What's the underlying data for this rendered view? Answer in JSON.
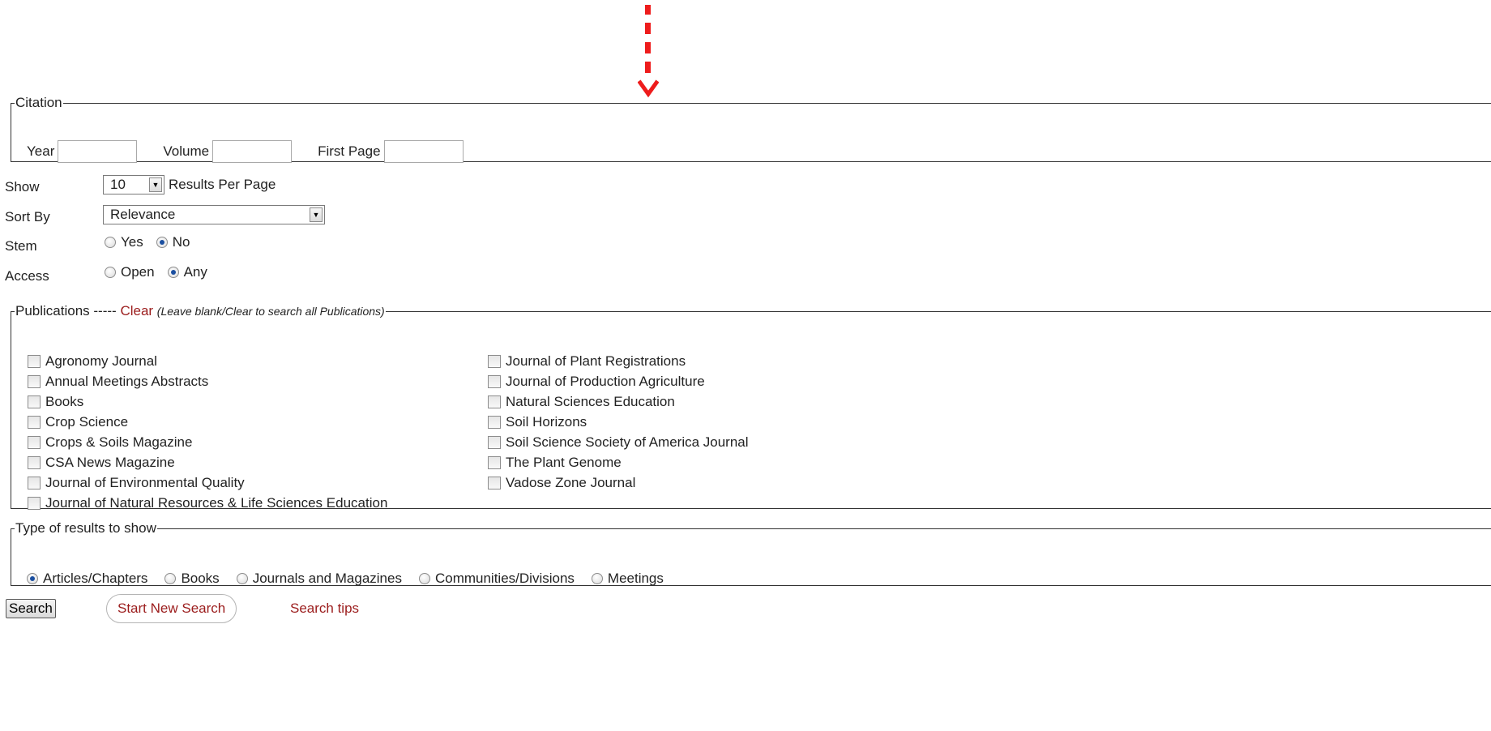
{
  "colors": {
    "accent_link": "#9b1c1c",
    "annotation_arrow": "#ee1c1c",
    "radio_selected": "#1b4fa0"
  },
  "citation": {
    "legend": "Citation",
    "year_label": "Year",
    "year_value": "",
    "volume_label": "Volume",
    "volume_value": "",
    "first_page_label": "First Page",
    "first_page_value": ""
  },
  "options": {
    "show_label": "Show",
    "show_value": "10",
    "show_suffix": "Results Per Page",
    "sort_label": "Sort By",
    "sort_value": "Relevance",
    "stem_label": "Stem",
    "stem_yes": "Yes",
    "stem_no": "No",
    "stem_selected": "No",
    "access_label": "Access",
    "access_open": "Open",
    "access_any": "Any",
    "access_selected": "Any"
  },
  "publications": {
    "legend_prefix": "Publications -----",
    "clear": "Clear",
    "hint": "(Leave blank/Clear to search all Publications)",
    "col1": [
      "Agronomy Journal",
      "Annual Meetings Abstracts",
      "Books",
      "Crop Science",
      "Crops & Soils Magazine",
      "CSA News Magazine",
      "Journal of Environmental Quality",
      "Journal of Natural Resources & Life Sciences Education"
    ],
    "col2": [
      "Journal of Plant Registrations",
      "Journal of Production Agriculture",
      "Natural Sciences Education",
      "Soil Horizons",
      "Soil Science Society of America Journal",
      "The Plant Genome",
      "Vadose Zone Journal"
    ]
  },
  "types": {
    "legend": "Type of results to show",
    "items": [
      "Articles/Chapters",
      "Books",
      "Journals and Magazines",
      "Communities/Divisions",
      "Meetings"
    ],
    "selected": "Articles/Chapters"
  },
  "actions": {
    "search": "Search",
    "new_search": "Start New Search",
    "tips": "Search tips"
  },
  "icons": {
    "annotation": "dashed-down-arrow-icon",
    "dropdown": "chevron-down-icon"
  }
}
